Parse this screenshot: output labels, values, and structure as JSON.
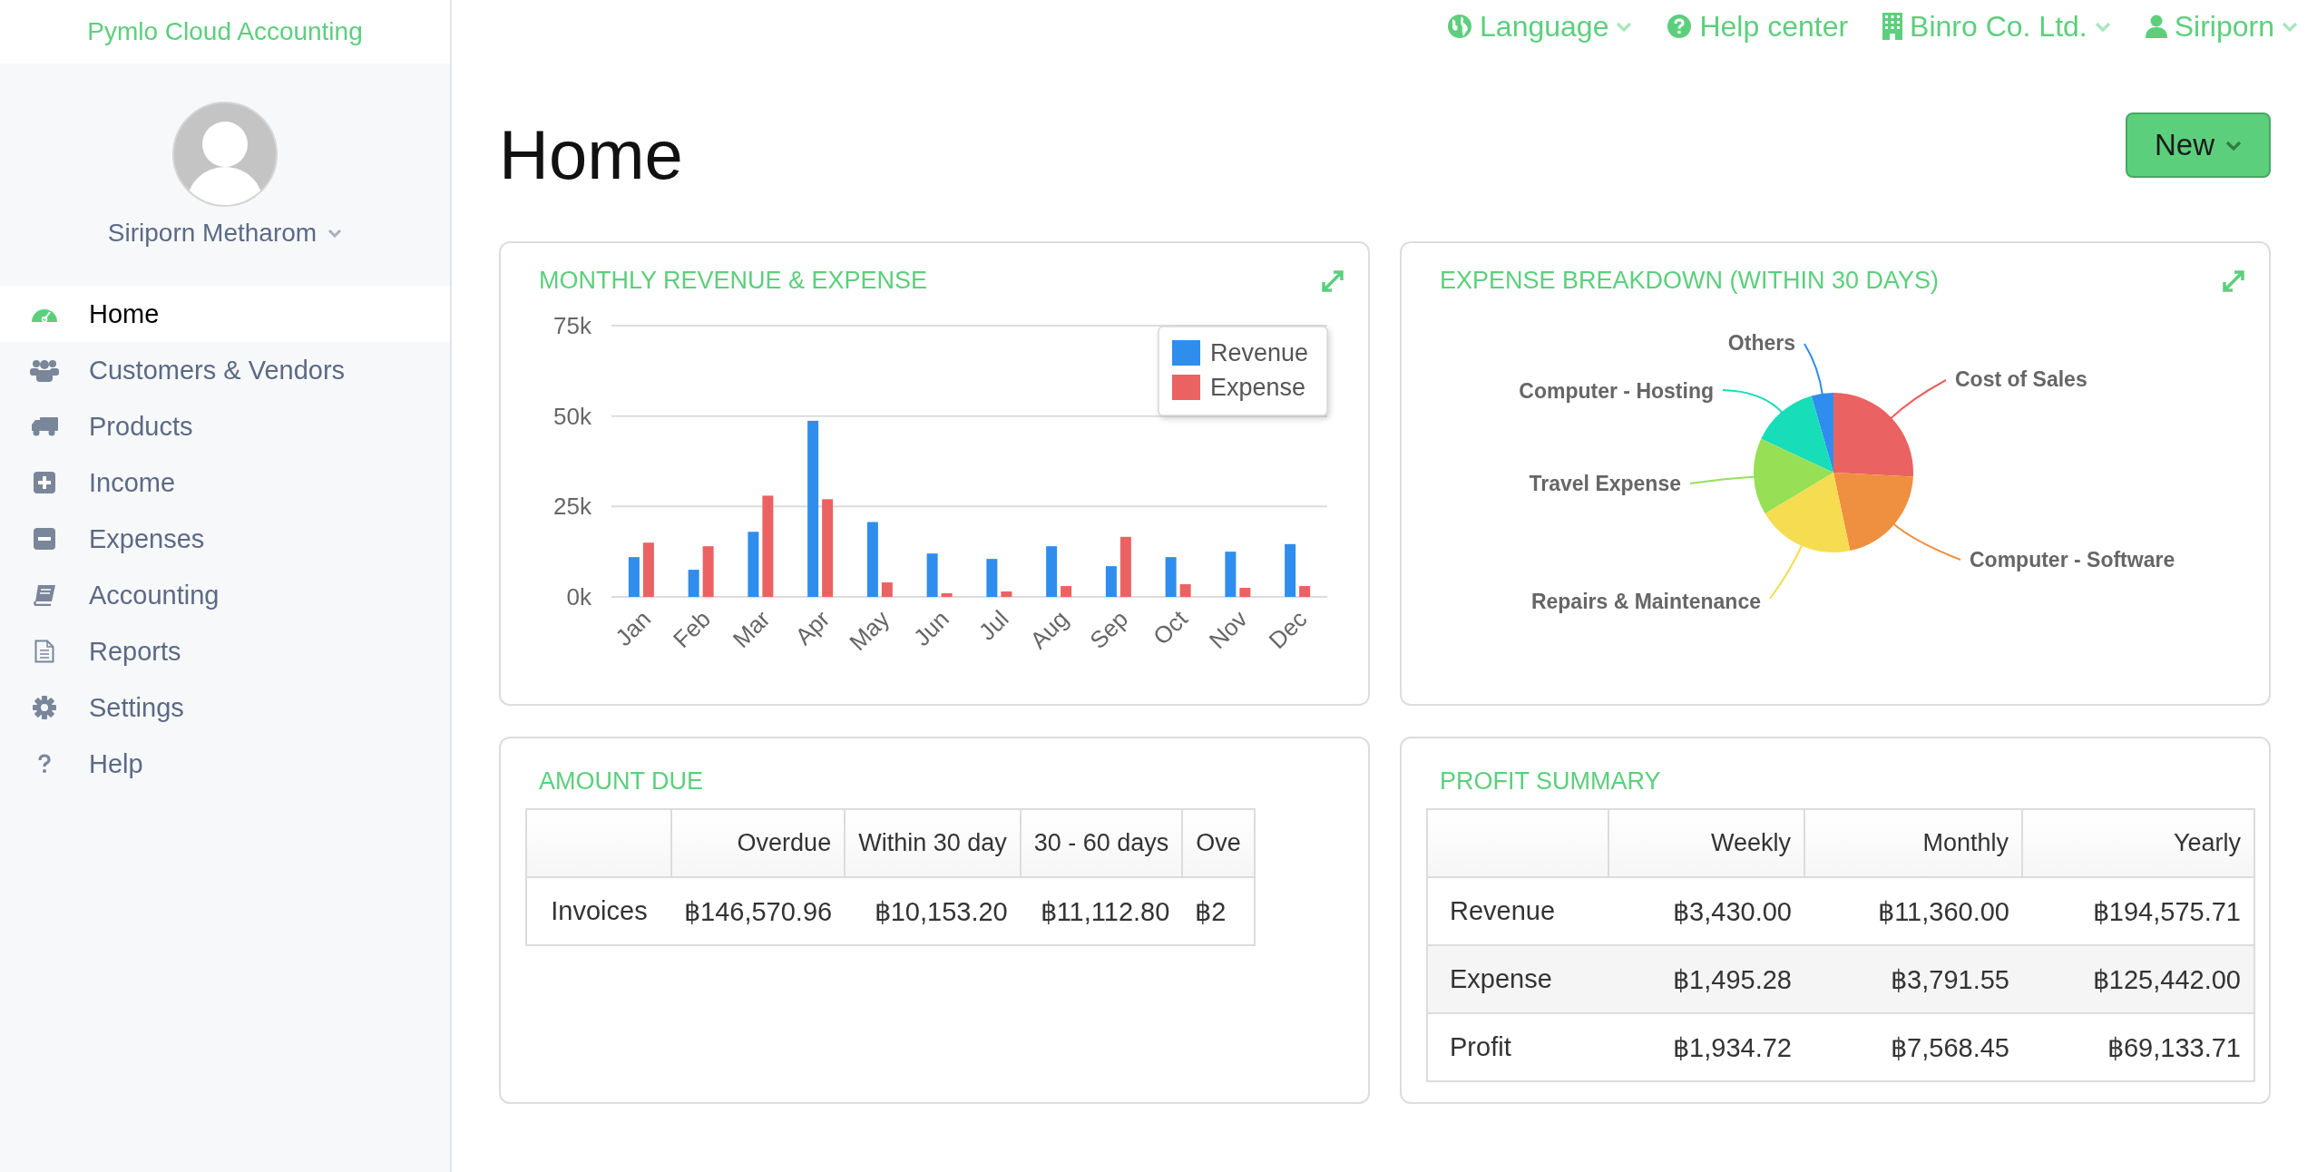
{
  "brand": "Pymlo Cloud Accounting",
  "user": {
    "name": "Siriporn Metharom"
  },
  "nav": [
    {
      "label": "Home",
      "kind": "gauge",
      "selected": true
    },
    {
      "label": "Customers & Vendors",
      "kind": "users",
      "selected": false
    },
    {
      "label": "Products",
      "kind": "truck",
      "selected": false
    },
    {
      "label": "Income",
      "kind": "plus",
      "selected": false
    },
    {
      "label": "Expenses",
      "kind": "minus",
      "selected": false
    },
    {
      "label": "Accounting",
      "kind": "book",
      "selected": false
    },
    {
      "label": "Reports",
      "kind": "document",
      "selected": false
    },
    {
      "label": "Settings",
      "kind": "gear",
      "selected": false
    },
    {
      "label": "Help",
      "kind": "question",
      "selected": false
    }
  ],
  "topbar": [
    {
      "label": "Language",
      "kind": "globe",
      "dropdown": true
    },
    {
      "label": "Help center",
      "kind": "help",
      "dropdown": false
    },
    {
      "label": "Binro Co. Ltd.",
      "kind": "building",
      "dropdown": true
    },
    {
      "label": "Siriporn",
      "kind": "user",
      "dropdown": true
    }
  ],
  "page_title": "Home",
  "new_button": "New",
  "revenue_chart": {
    "title": "MONTHLY REVENUE & EXPENSE",
    "chart_data": {
      "type": "bar",
      "categories": [
        "Jan",
        "Feb",
        "Mar",
        "Apr",
        "May",
        "Jun",
        "Jul",
        "Aug",
        "Sep",
        "Oct",
        "Nov",
        "Dec"
      ],
      "series": [
        {
          "name": "Revenue",
          "color": "#2f8ded",
          "values": [
            11000,
            7500,
            18000,
            48700,
            20700,
            12000,
            10500,
            14000,
            8500,
            11000,
            12500,
            14600
          ]
        },
        {
          "name": "Expense",
          "color": "#eb6262",
          "values": [
            15000,
            14000,
            28000,
            27000,
            4000,
            1000,
            1500,
            3000,
            16600,
            3500,
            2500,
            3000
          ]
        }
      ],
      "ylim": [
        0,
        75000
      ],
      "legend": true,
      "yticks": [
        {
          "value": 0,
          "label": "0k"
        },
        {
          "value": 25000,
          "label": "25k"
        },
        {
          "value": 50000,
          "label": "50k"
        },
        {
          "value": 75000,
          "label": "75k"
        }
      ]
    }
  },
  "expense_breakdown": {
    "title": "EXPENSE BREAKDOWN (WITHIN 30 DAYS)",
    "slices": [
      {
        "label": "Others",
        "color": "#2f8ded"
      },
      {
        "label": "Computer - Hosting",
        "color": "#18ddb9"
      },
      {
        "label": "Cost of Sales",
        "color": "#eb6262"
      },
      {
        "label": "Travel Expense",
        "color": "#97e055"
      },
      {
        "label": "Computer - Software",
        "color": "#ef8f40"
      },
      {
        "label": "Repairs & Maintenance",
        "color": "#f6dc50"
      }
    ]
  },
  "amount_due": {
    "title": "AMOUNT DUE",
    "columns": [
      "Overdue",
      "Within 30 day",
      "30 - 60 days",
      "Ove"
    ],
    "rows": [
      {
        "label": "Invoices",
        "cells": [
          "฿146,570.96",
          "฿10,153.20",
          "฿11,112.80",
          "฿2"
        ]
      }
    ]
  },
  "profit_summary": {
    "title": "PROFIT SUMMARY",
    "columns": [
      "Weekly",
      "Monthly",
      "Yearly"
    ],
    "rows": [
      {
        "label": "Revenue",
        "cells": [
          "฿3,430.00",
          "฿11,360.00",
          "฿194,575.71"
        ]
      },
      {
        "label": "Expense",
        "cells": [
          "฿1,495.28",
          "฿3,791.55",
          "฿125,442.00"
        ]
      },
      {
        "label": "Profit",
        "cells": [
          "฿1,934.72",
          "฿7,568.45",
          "฿69,133.71"
        ]
      }
    ]
  }
}
